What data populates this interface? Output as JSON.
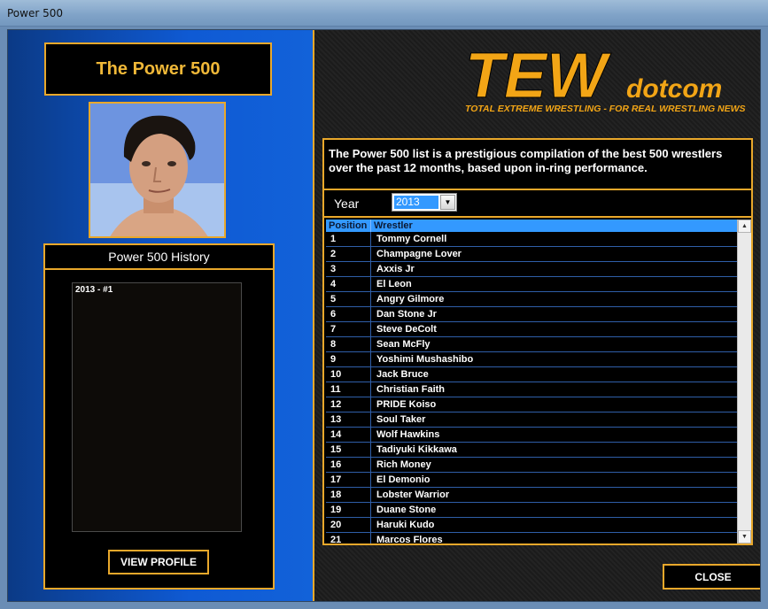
{
  "window": {
    "title": "Power 500"
  },
  "left": {
    "wrestler_name": "The Power 500",
    "history_title": "Power 500 History",
    "history_items": [
      "2013 - #1"
    ],
    "view_profile_label": "VIEW PROFILE"
  },
  "right": {
    "logo": {
      "main": "TEW",
      "suffix": "dotcom",
      "tagline": "TOTAL EXTREME WRESTLING - FOR REAL WRESTLING NEWS"
    },
    "description": "The Power 500 list is a prestigious compilation of the best 500 wrestlers over the past 12 months, based upon in-ring performance.",
    "year_label": "Year",
    "year_value": "2013",
    "columns": {
      "position": "Position",
      "wrestler": "Wrestler"
    },
    "rows": [
      {
        "pos": "1",
        "name": "Tommy Cornell"
      },
      {
        "pos": "2",
        "name": "Champagne Lover"
      },
      {
        "pos": "3",
        "name": "Axxis Jr"
      },
      {
        "pos": "4",
        "name": "El Leon"
      },
      {
        "pos": "5",
        "name": "Angry Gilmore"
      },
      {
        "pos": "6",
        "name": "Dan Stone Jr"
      },
      {
        "pos": "7",
        "name": "Steve DeColt"
      },
      {
        "pos": "8",
        "name": "Sean McFly"
      },
      {
        "pos": "9",
        "name": "Yoshimi Mushashibo"
      },
      {
        "pos": "10",
        "name": "Jack Bruce"
      },
      {
        "pos": "11",
        "name": "Christian Faith"
      },
      {
        "pos": "12",
        "name": "PRIDE Koiso"
      },
      {
        "pos": "13",
        "name": "Soul Taker"
      },
      {
        "pos": "14",
        "name": "Wolf Hawkins"
      },
      {
        "pos": "15",
        "name": "Tadiyuki Kikkawa"
      },
      {
        "pos": "16",
        "name": "Rich Money"
      },
      {
        "pos": "17",
        "name": "El Demonio"
      },
      {
        "pos": "18",
        "name": "Lobster Warrior"
      },
      {
        "pos": "19",
        "name": "Duane Stone"
      },
      {
        "pos": "20",
        "name": "Haruki Kudo"
      },
      {
        "pos": "21",
        "name": "Marcos Flores"
      }
    ],
    "close_label": "CLOSE"
  },
  "colors": {
    "accent": "#e9a82b",
    "panel_blue": "#0f5ad4",
    "selection": "#3399ff"
  }
}
